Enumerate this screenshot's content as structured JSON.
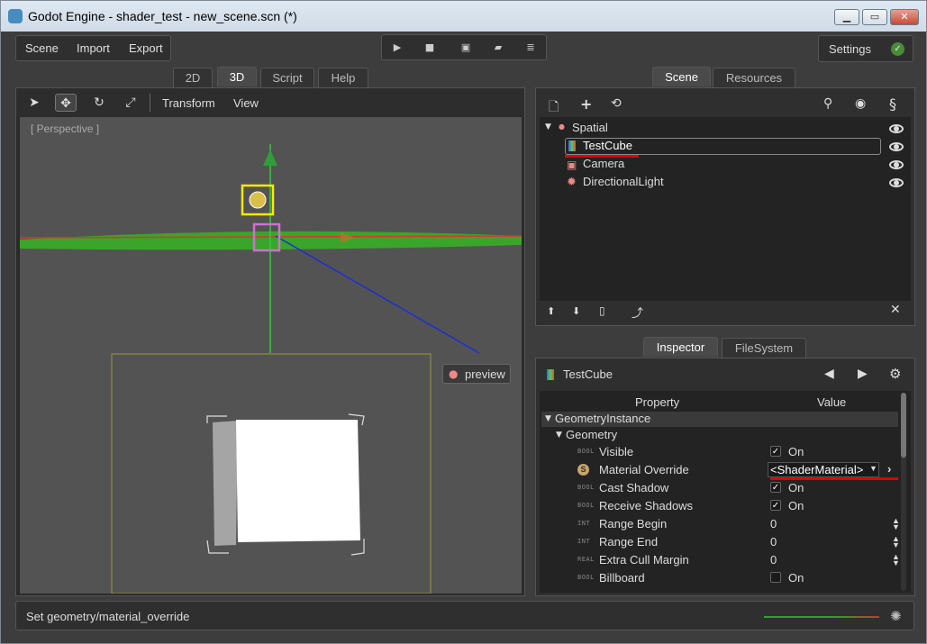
{
  "window": {
    "title": "Godot Engine - shader_test - new_scene.scn (*)"
  },
  "menu": {
    "items": [
      "Scene",
      "Import",
      "Export"
    ]
  },
  "settings_label": "Settings",
  "editor_tabs": [
    "2D",
    "3D",
    "Script",
    "Help"
  ],
  "viewport": {
    "toolbar_menus": [
      "Transform",
      "View"
    ],
    "perspective_label": "[ Perspective ]",
    "preview_label": "preview"
  },
  "scene_tabs": [
    "Scene",
    "Resources"
  ],
  "scene_tree": [
    {
      "label": "Spatial",
      "icon": "spatial-icon",
      "color": "#e88"
    },
    {
      "label": "TestCube",
      "icon": "mesh-instance-icon",
      "color": "#5c5"
    },
    {
      "label": "Camera",
      "icon": "camera-icon",
      "color": "#e88"
    },
    {
      "label": "DirectionalLight",
      "icon": "light-icon",
      "color": "#e88"
    }
  ],
  "inspector_tabs": [
    "Inspector",
    "FileSystem"
  ],
  "inspector": {
    "object_name": "TestCube",
    "header": {
      "property": "Property",
      "value": "Value"
    },
    "section": "GeometryInstance",
    "subsection": "Geometry",
    "rows": [
      {
        "tag": "BOOL",
        "name": "Visible",
        "type": "check",
        "checked": true,
        "value": "On"
      },
      {
        "tag": "",
        "name": "Material Override",
        "type": "resource",
        "value": "<ShaderMaterial>"
      },
      {
        "tag": "BOOL",
        "name": "Cast Shadow",
        "type": "check",
        "checked": true,
        "value": "On"
      },
      {
        "tag": "BOOL",
        "name": "Receive Shadows",
        "type": "check",
        "checked": true,
        "value": "On"
      },
      {
        "tag": "INT",
        "name": "Range Begin",
        "type": "spin",
        "value": "0"
      },
      {
        "tag": "INT",
        "name": "Range End",
        "type": "spin",
        "value": "0"
      },
      {
        "tag": "REAL",
        "name": "Extra Cull Margin",
        "type": "spin",
        "value": "0"
      },
      {
        "tag": "BOOL",
        "name": "Billboard",
        "type": "check",
        "checked": false,
        "value": "On"
      }
    ]
  },
  "status_text": "Set geometry/material_override",
  "colors": {
    "accent": "#e00000",
    "green_axis": "#2ecc40",
    "highlight_yellow": "#ffea00"
  }
}
